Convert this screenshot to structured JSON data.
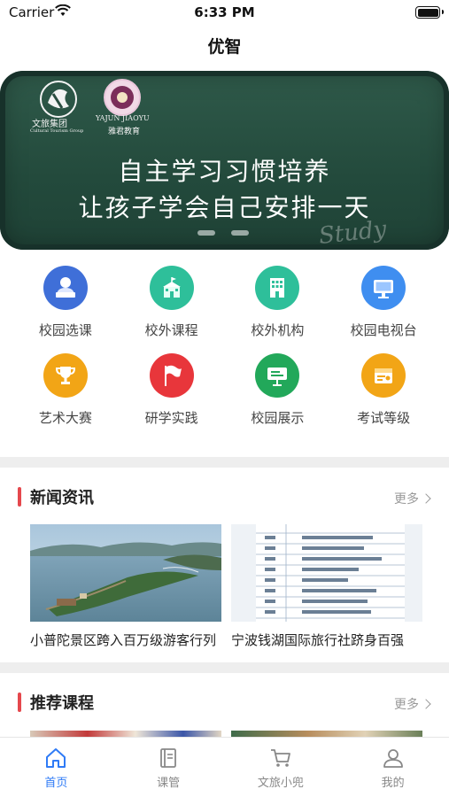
{
  "status_bar": {
    "carrier": "Carrier",
    "time": "6:33 PM"
  },
  "nav": {
    "title": "优智"
  },
  "banner": {
    "logo_left_caption": "文旅集团",
    "logo_left_sub": "Cultural Tourism Group",
    "logo_right_top": "YAJUN JIAOYU",
    "logo_right_caption": "雅君教育",
    "headline_1": "自主学习习惯培养",
    "headline_2": "让孩子学会自己安排一天",
    "watermark": "Study",
    "active_slide": 1,
    "slide_count": 2
  },
  "grid": {
    "row1": [
      {
        "label": "校园选课",
        "icon": "student-desk-icon",
        "color": "#3f6fd8"
      },
      {
        "label": "校外课程",
        "icon": "school-building-icon",
        "color": "#2ebf9a"
      },
      {
        "label": "校外机构",
        "icon": "office-building-icon",
        "color": "#2ebf9a"
      },
      {
        "label": "校园电视台",
        "icon": "monitor-icon",
        "color": "#3f8ef0"
      }
    ],
    "row2": [
      {
        "label": "艺术大赛",
        "icon": "trophy-icon",
        "color": "#f2a516"
      },
      {
        "label": "研学实践",
        "icon": "flag-icon",
        "color": "#e8363b"
      },
      {
        "label": "校园展示",
        "icon": "presentation-board-icon",
        "color": "#22a85a"
      },
      {
        "label": "考试等级",
        "icon": "certificate-icon",
        "color": "#f2a516"
      }
    ]
  },
  "news": {
    "title": "新闻资讯",
    "more": "更多",
    "items": [
      {
        "caption": "小普陀景区跨入百万级游客行列"
      },
      {
        "caption": "宁波钱湖国际旅行社跻身百强"
      }
    ]
  },
  "courses": {
    "title": "推荐课程",
    "more": "更多"
  },
  "tabbar": {
    "tabs": [
      {
        "label": "首页",
        "icon": "home-icon",
        "active": true
      },
      {
        "label": "课管",
        "icon": "notebook-icon",
        "active": false
      },
      {
        "label": "文旅小兜",
        "icon": "cart-icon",
        "active": false
      },
      {
        "label": "我的",
        "icon": "person-icon",
        "active": false
      }
    ],
    "active_color": "#2f7bf6"
  }
}
